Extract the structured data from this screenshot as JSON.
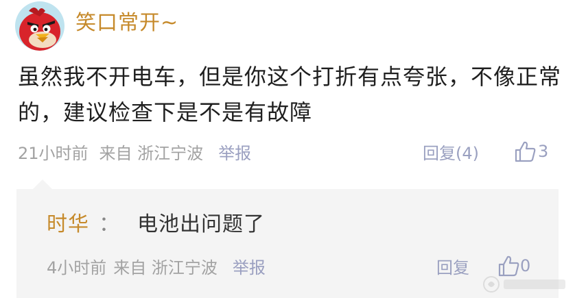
{
  "comment": {
    "username": "笑口常开~",
    "avatar_icon": "angry-bird-avatar",
    "text": "虽然我不开电车，但是你这个打折有点夸张，不像正常的，建议检查下是不是有故障",
    "time": "21小时前",
    "source": "来自 浙江宁波",
    "report_label": "举报",
    "reply_label": "回复(4)",
    "like_count": "3"
  },
  "reply": {
    "author": "时华",
    "separator": "：",
    "text": "电池出问题了",
    "time": "4小时前",
    "source": "来自 浙江宁波",
    "report_label": "举报",
    "reply_label": "回复",
    "like_count": "0"
  },
  "colors": {
    "username": "#c68a2b",
    "link": "#9aa0c0",
    "meta": "#a2a2a2",
    "reply_bg": "#f4f4f4"
  }
}
